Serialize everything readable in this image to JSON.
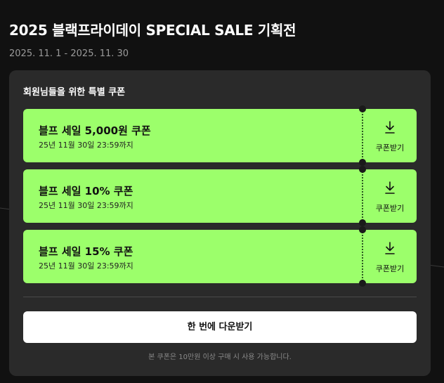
{
  "page": {
    "title": "2025 블랙프라이데이 SPECIAL SALE 기획전",
    "period": "2025. 11. 1 - 2025. 11. 30"
  },
  "panel": {
    "title": "회원님들을 위한 특별 쿠폰",
    "coupons": [
      {
        "name": "블프 세일 5,000원 쿠폰",
        "expiry": "25년 11월 30일 23:59까지",
        "download_label": "쿠폰받기"
      },
      {
        "name": "블프 세일 10% 쿠폰",
        "expiry": "25년 11월 30일 23:59까지",
        "download_label": "쿠폰받기"
      },
      {
        "name": "블프 세일 15% 쿠폰",
        "expiry": "25년 11월 30일 23:59까지",
        "download_label": "쿠폰받기"
      }
    ],
    "download_all_label": "한 번에 다운받기",
    "notice": "본 쿠폰은 10만원 이상 구매 시 사용 가능합니다."
  },
  "colors": {
    "background": "#111111",
    "panel": "#2a2a2a",
    "coupon": "#9cff6b",
    "button": "#ffffff"
  },
  "icons": {
    "download": "download-icon"
  }
}
